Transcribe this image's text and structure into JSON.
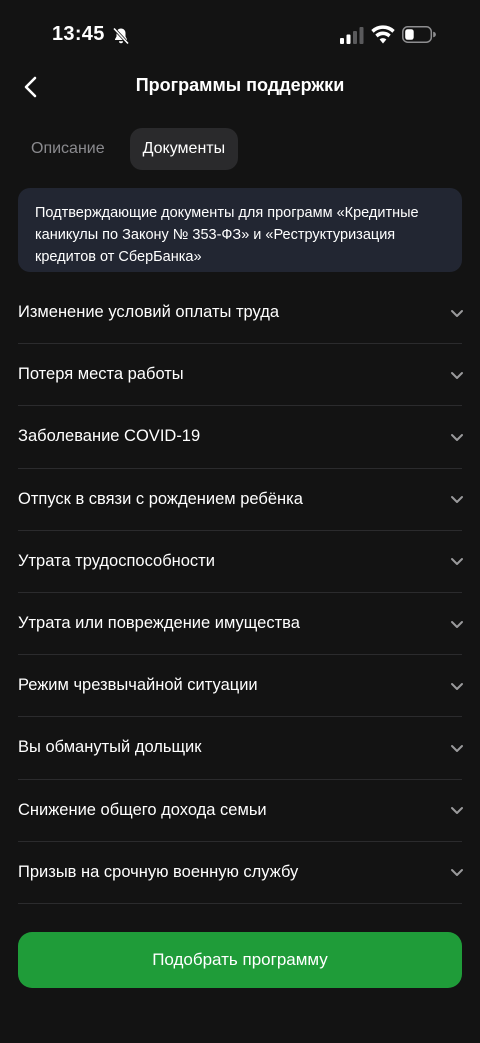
{
  "status_bar": {
    "time": "13:45"
  },
  "header": {
    "title": "Программы поддержки"
  },
  "tabs": [
    {
      "label": "Описание",
      "active": false
    },
    {
      "label": "Документы",
      "active": true
    }
  ],
  "info": {
    "text": "Подтверждающие документы для программ «Кредитные каникулы по Закону № 353-ФЗ» и «Реструктуризация кредитов от СберБанка»"
  },
  "list": [
    {
      "label": "Изменение условий оплаты труда"
    },
    {
      "label": "Потеря места работы"
    },
    {
      "label": "Заболевание COVID-19"
    },
    {
      "label": "Отпуск в связи с рождением ребёнка"
    },
    {
      "label": "Утрата трудоспособности"
    },
    {
      "label": "Утрата или повреждение имущества"
    },
    {
      "label": "Режим чрезвычайной ситуации"
    },
    {
      "label": "Вы обманутый дольщик"
    },
    {
      "label": "Снижение общего дохода семьи"
    },
    {
      "label": "Призыв на срочную военную службу"
    }
  ],
  "cta": {
    "label": "Подобрать программу"
  },
  "colors": {
    "background": "#131313",
    "accent_green": "#1f9c39",
    "info_bg": "#222632"
  }
}
